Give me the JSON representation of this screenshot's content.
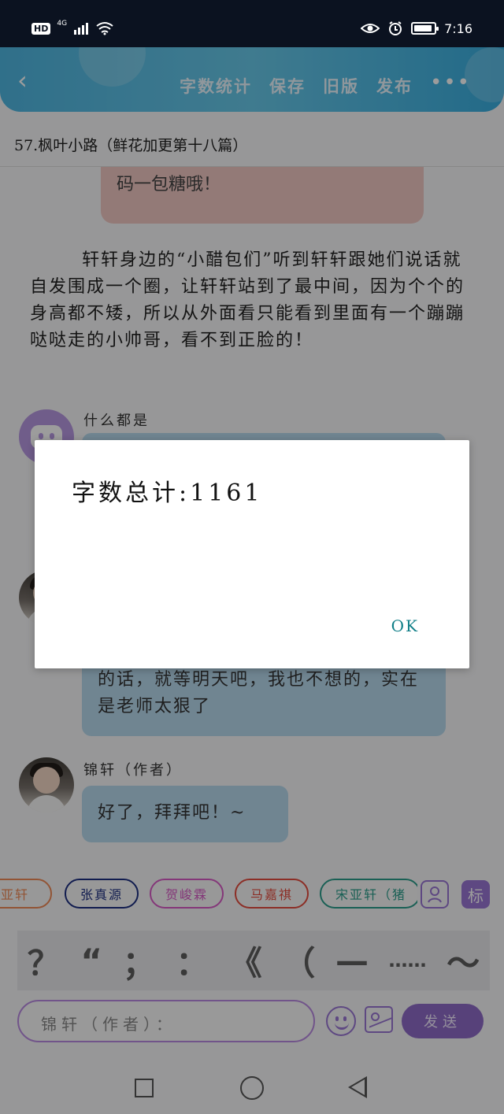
{
  "status": {
    "network": "4G",
    "hd": "HD",
    "time": "7:16"
  },
  "toolbar": {
    "back": "‹",
    "items": [
      "字数统计",
      "保存",
      "旧版",
      "发布"
    ],
    "more": "•••"
  },
  "chapter": {
    "title": "57.枫叶小路（鲜花加更第十八篇）"
  },
  "messages": {
    "top_bubble": "码一包糖哦！",
    "paragraph": "轩轩身边的“小醋包们”听到轩轩跟她们说话就自发围成一个圈，让轩轩站到了最中间，因为个个的身高都不矮，所以从外面看只能看到里面有一个蹦蹦哒哒走的小帅哥，看不到正脸的！",
    "speaker1": "什么都是",
    "speaker2_text": "的话，就等明天吧，我也不想的，实在是老师太狠了",
    "author_name": "锦轩（作者）",
    "author_text": "好了，拜拜吧！~"
  },
  "tags": [
    "宋亚轩",
    "张真源",
    "贺峻霖",
    "马嘉祺",
    "宋亚轩（猪"
  ],
  "icons": {
    "person": "person-icon",
    "mark": "标"
  },
  "punctuation": [
    "？",
    "“",
    "；",
    "：",
    "《",
    "（",
    "—",
    "……",
    "～"
  ],
  "input": {
    "placeholder": "锦轩（作者）："
  },
  "send": "发送",
  "dialog": {
    "message": "字数总计:1161",
    "ok": "OK"
  },
  "colors": {
    "accent_blue": "#4fb7e2",
    "purple": "#8e6bc8",
    "dialog_ok": "#0f7e87"
  }
}
